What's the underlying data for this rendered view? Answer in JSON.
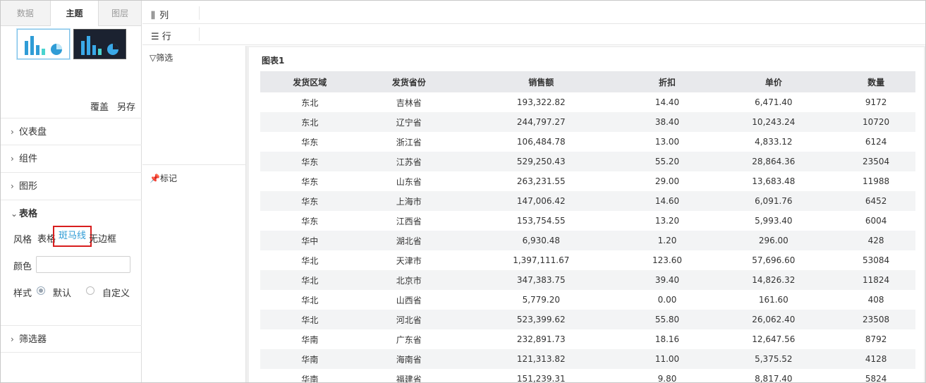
{
  "tabs": [
    "数据",
    "主题",
    "图层"
  ],
  "theme_presets": [
    "light-theme",
    "dark-theme"
  ],
  "actions": {
    "overwrite": "覆盖",
    "save_as": "另存"
  },
  "sections": {
    "dashboard": "仪表盘",
    "component": "组件",
    "graphics": "图形",
    "table": "表格",
    "filter": "筛选器"
  },
  "table_props": {
    "style_label": "风格",
    "style_options": [
      "表格",
      "斑马线",
      "无边框"
    ],
    "selected_style": "斑马线",
    "color_label": "颜色",
    "color_value": "",
    "mode_label": "样式",
    "mode_options": [
      "默认",
      "自定义"
    ],
    "selected_mode": "默认"
  },
  "shelf": {
    "columns": "列",
    "rows": "行"
  },
  "marks_panel": {
    "filter": "筛选",
    "marks": "标记"
  },
  "chart": {
    "title": "图表1",
    "headers": [
      "发货区域",
      "发货省份",
      "销售额",
      "折扣",
      "单价",
      "数量"
    ],
    "rows": [
      [
        "东北",
        "吉林省",
        "193,322.82",
        "14.40",
        "6,471.40",
        "9172"
      ],
      [
        "东北",
        "辽宁省",
        "244,797.27",
        "38.40",
        "10,243.24",
        "10720"
      ],
      [
        "华东",
        "浙江省",
        "106,484.78",
        "13.00",
        "4,833.12",
        "6124"
      ],
      [
        "华东",
        "江苏省",
        "529,250.43",
        "55.20",
        "28,864.36",
        "23504"
      ],
      [
        "华东",
        "山东省",
        "263,231.55",
        "29.00",
        "13,683.48",
        "11988"
      ],
      [
        "华东",
        "上海市",
        "147,006.42",
        "14.60",
        "6,091.76",
        "6452"
      ],
      [
        "华东",
        "江西省",
        "153,754.55",
        "13.20",
        "5,993.40",
        "6004"
      ],
      [
        "华中",
        "湖北省",
        "6,930.48",
        "1.20",
        "296.00",
        "428"
      ],
      [
        "华北",
        "天津市",
        "1,397,111.67",
        "123.60",
        "57,696.60",
        "53084"
      ],
      [
        "华北",
        "北京市",
        "347,383.75",
        "39.40",
        "14,826.32",
        "11824"
      ],
      [
        "华北",
        "山西省",
        "5,779.20",
        "0.00",
        "161.60",
        "408"
      ],
      [
        "华北",
        "河北省",
        "523,399.62",
        "55.80",
        "26,062.40",
        "23508"
      ],
      [
        "华南",
        "广东省",
        "232,891.73",
        "18.16",
        "12,647.56",
        "8792"
      ],
      [
        "华南",
        "海南省",
        "121,313.82",
        "11.00",
        "5,375.52",
        "4128"
      ],
      [
        "华南",
        "福建省",
        "151,239.31",
        "9.80",
        "8,817.40",
        "5824"
      ]
    ]
  },
  "colors": {
    "accent": "#2f9cd6",
    "highlight_box": "#d81e1e",
    "header_bg": "#e8e9ec",
    "stripe_bg": "#f3f4f5"
  }
}
